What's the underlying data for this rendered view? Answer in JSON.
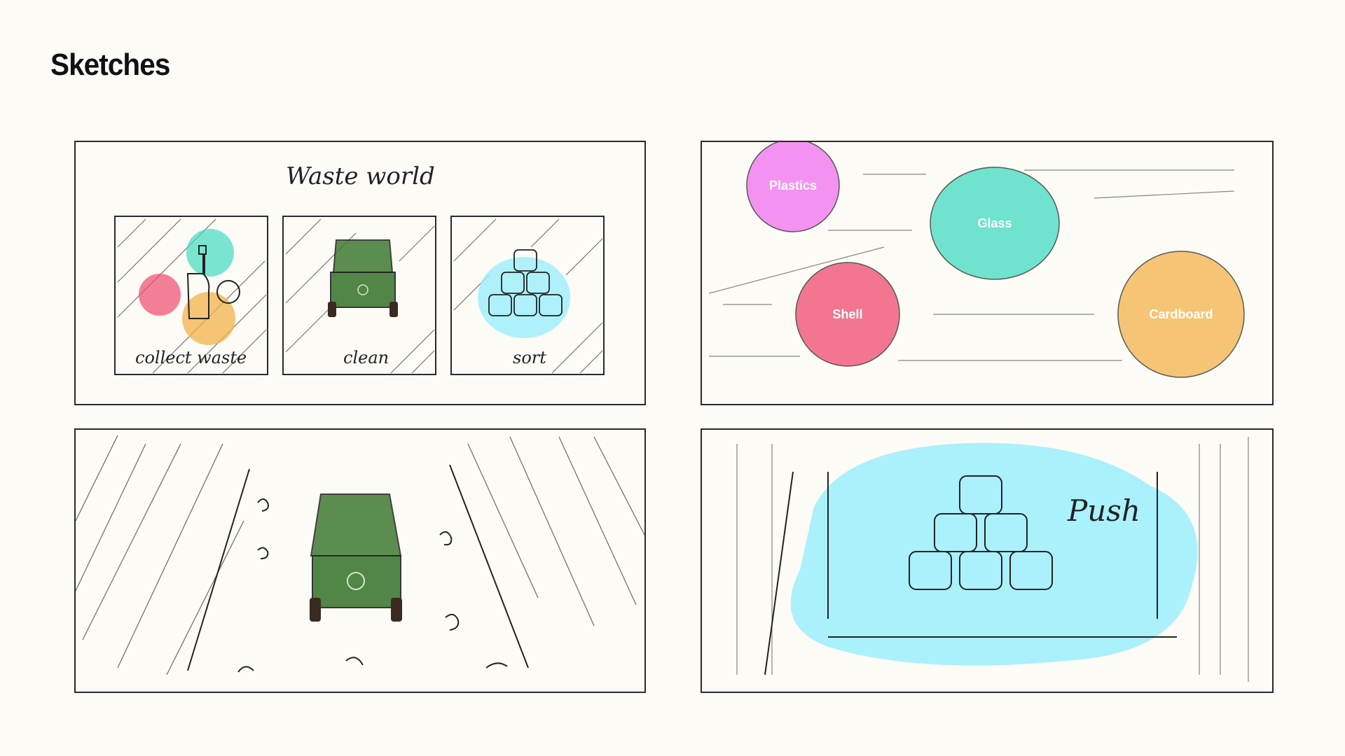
{
  "page": {
    "title": "Sketches"
  },
  "menu_panel": {
    "heading": "Waste world",
    "cards": [
      {
        "label": "collect waste"
      },
      {
        "label": "clean"
      },
      {
        "label": "sort"
      }
    ]
  },
  "bubbles_panel": {
    "bubbles": [
      {
        "label": "Plastics",
        "color": "#f26ff0"
      },
      {
        "label": "Glass",
        "color": "#41dcc0"
      },
      {
        "label": "Shell",
        "color": "#f04a6e"
      },
      {
        "label": "Cardboard",
        "color": "#f3b34a"
      }
    ]
  },
  "road_panel": {},
  "push_panel": {
    "label": "Push",
    "wash_color": "#9beffd"
  },
  "colors": {
    "background": "#fcfbf6",
    "ink": "#2a2a2a",
    "cart_green": "#3f7a34",
    "wheel": "#3a2a22"
  }
}
